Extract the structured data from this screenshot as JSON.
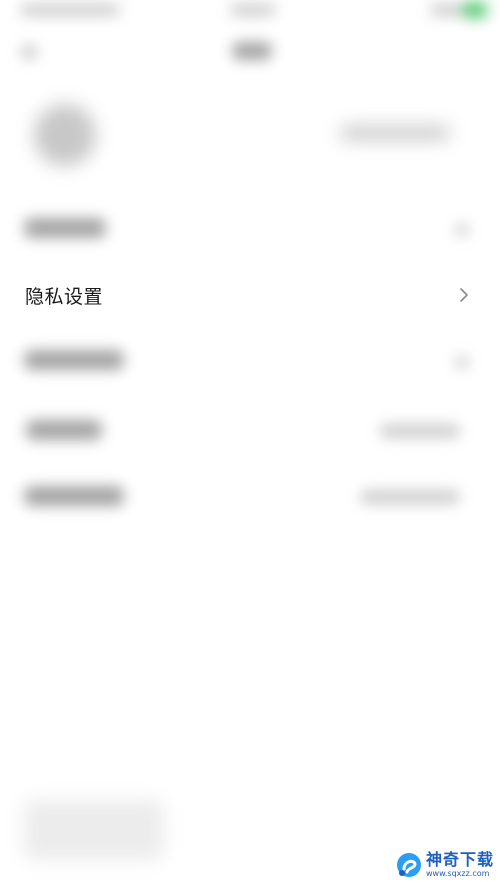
{
  "settings": {
    "privacy_label": "隐私设置"
  },
  "watermark": {
    "title": "神奇下载",
    "url": "www.sqxzz.com",
    "logo_icon": "sq-logo-icon",
    "color": "#1e5fbf"
  },
  "icons": {
    "chevron": "chevron-right-icon"
  },
  "colors": {
    "status_accent": "#43c463",
    "text": "#1b1b1b"
  }
}
